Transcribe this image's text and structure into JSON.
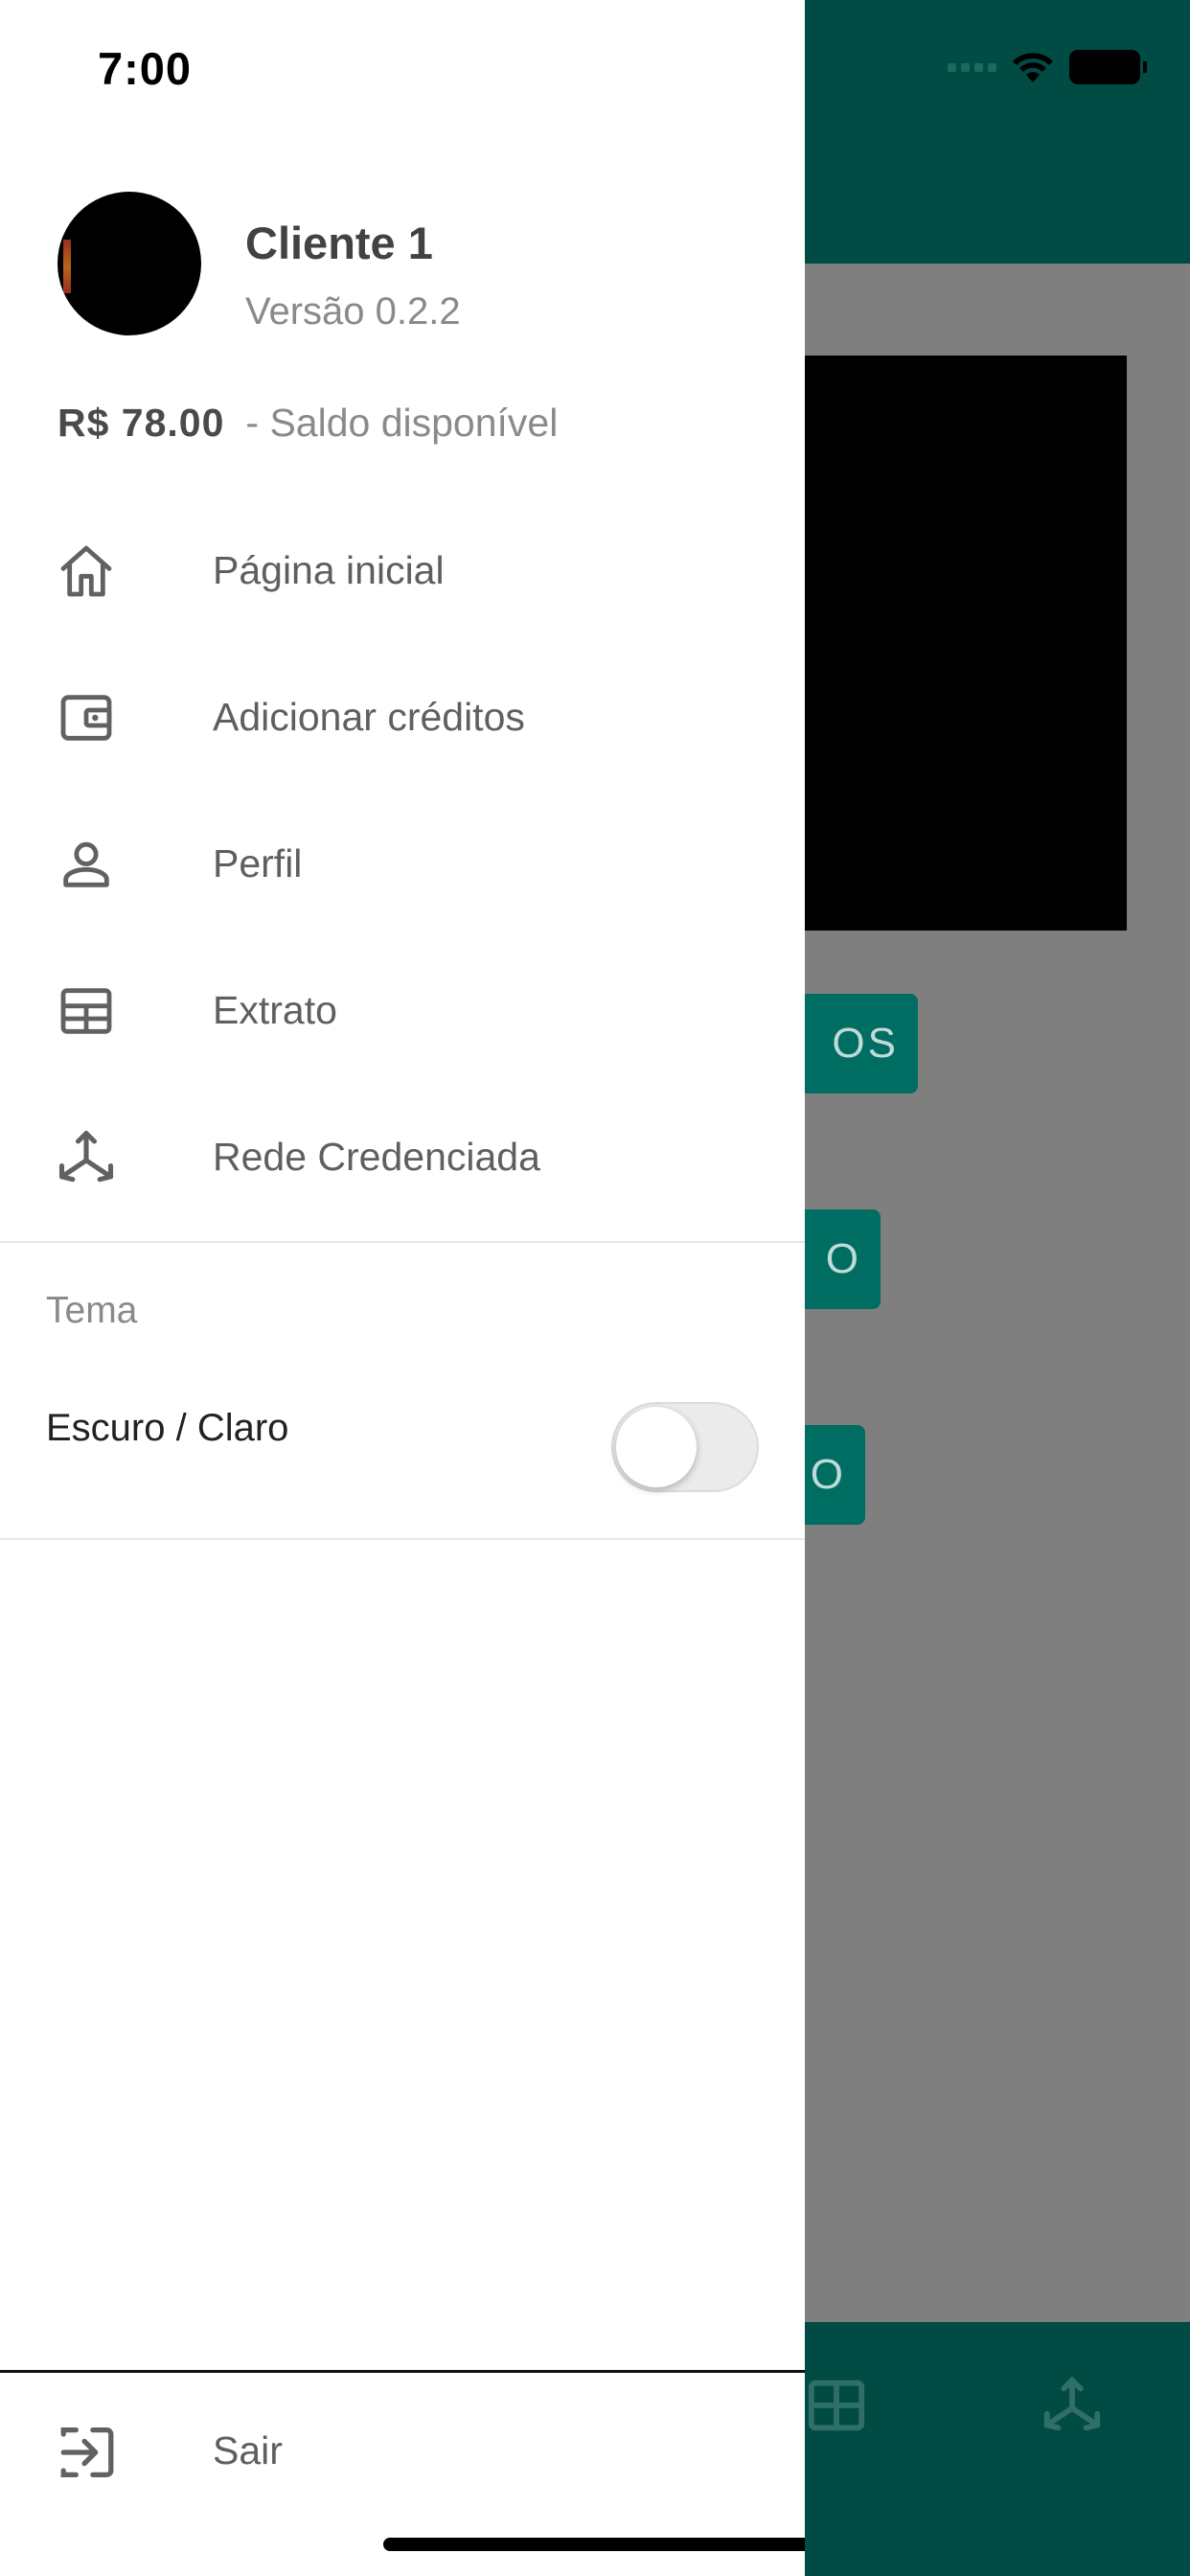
{
  "status_bar": {
    "time": "7:00"
  },
  "background": {
    "button1_text": "OS",
    "button2_text": "O",
    "button3_text": "O"
  },
  "drawer": {
    "user": {
      "name": "Cliente 1",
      "version": "Versão 0.2.2"
    },
    "balance": {
      "value": "R$ 78.00",
      "label": "- Saldo disponível"
    },
    "menu": [
      {
        "label": "Página inicial",
        "icon": "home-icon"
      },
      {
        "label": "Adicionar créditos",
        "icon": "wallet-icon"
      },
      {
        "label": "Perfil",
        "icon": "person-icon"
      },
      {
        "label": "Extrato",
        "icon": "table-icon"
      },
      {
        "label": "Rede Credenciada",
        "icon": "network-icon"
      }
    ],
    "theme": {
      "section_title": "Tema",
      "toggle_label": "Escuro / Claro",
      "toggle_on": false
    },
    "logout": {
      "label": "Sair",
      "icon": "logout-icon"
    }
  },
  "colors": {
    "brand_dark": "#004b44",
    "brand_button": "#006d62",
    "overlay_gray": "#7f7f7f",
    "icon_gray": "#616161"
  }
}
